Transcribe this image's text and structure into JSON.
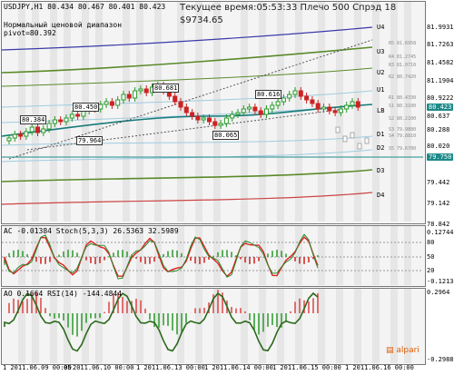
{
  "header": {
    "symbol_line": "USDJPY,H1  80.434 80.467 80.401 80.423",
    "range_label": "Нормальный ценовой диапазон",
    "pivot_label": "pivot=80.392",
    "server_time": "Текущее время:05:53:33 Плечо 500 Спрэд 18",
    "balance": "$9734.65"
  },
  "price_axis": [
    {
      "label": "81.9931",
      "color": "#000"
    },
    {
      "label": "81.7263",
      "color": "#000"
    },
    {
      "label": "81.4582",
      "color": "#000"
    },
    {
      "label": "81.1904",
      "color": "#000"
    },
    {
      "label": "80.9222",
      "color": "#000"
    },
    {
      "label": "80.637",
      "color": "#000"
    },
    {
      "label": "80.423",
      "color": "#1d8a8a"
    },
    {
      "label": "80.288",
      "color": "#000"
    },
    {
      "label": "80.020",
      "color": "#000"
    },
    {
      "label": "79.750",
      "color": "#1d8a8a"
    },
    {
      "label": "79.442",
      "color": "#000"
    },
    {
      "label": "79.142",
      "color": "#000"
    },
    {
      "label": "78.842",
      "color": "#000"
    }
  ],
  "level_labels": [
    {
      "name": "U4",
      "color": "#000"
    },
    {
      "name": "U3",
      "color": "#000"
    },
    {
      "name": "U2",
      "color": "#000"
    },
    {
      "name": "U1",
      "color": "#000"
    },
    {
      "name": "LB",
      "color": "#000"
    },
    {
      "name": "D1",
      "color": "#000"
    },
    {
      "name": "D2",
      "color": "#000"
    },
    {
      "name": "D3",
      "color": "#000"
    },
    {
      "name": "D4",
      "color": "#000"
    }
  ],
  "level_values": [
    "R5 81.6958",
    "R4 81.2745",
    "R3 81.0710",
    "R2 80.7420",
    "R1 80.4330",
    "S1 80.3100",
    "S2 80.2100",
    "S3 79.9880",
    "S4 79.8810",
    "S5 79.6780"
  ],
  "chart_tags": [
    "80.681",
    "80.616",
    "80.450",
    "80.384",
    "79.964",
    "80.065"
  ],
  "ac_panel": {
    "title": "AC -0.01384  Stoch(5,3,3) 26.5363 32.5989",
    "axis": [
      "0.12744",
      "80",
      "50",
      "20",
      "-0.12134"
    ]
  },
  "ao_panel": {
    "title": "AO 0.1664  RSI(14) -144.4844",
    "axis": [
      "0.2964",
      "-0.2988"
    ]
  },
  "time_axis": [
    "1 2011.06.09 00:00",
    "05",
    "2011.06.10 00:00",
    "1 2011.06.13 00:00",
    "1 2011.06.14 00:00",
    "1 2011.06.15 00:00",
    "1 2011.06.16 00:00"
  ],
  "branding": "alpari",
  "colors": {
    "accent": "#1d8a8a",
    "bull": "#2a9a2a",
    "bear": "#cc2222",
    "bands": "#5a8a2a",
    "ma": "#167a7a"
  }
}
